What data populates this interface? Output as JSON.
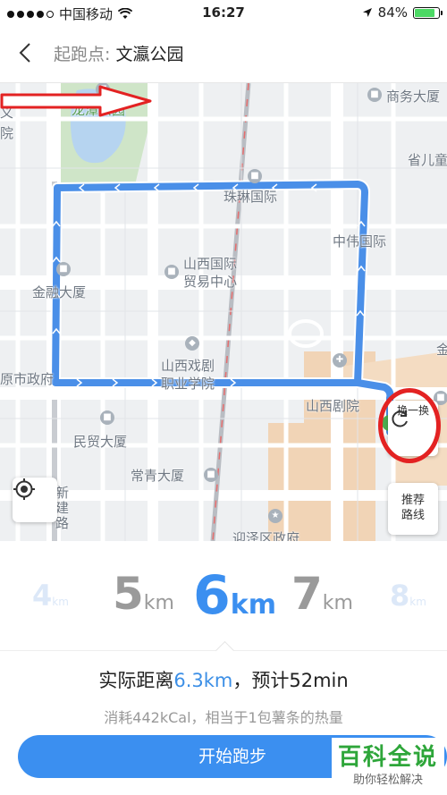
{
  "status_bar": {
    "carrier": "中国移动",
    "time": "16:27",
    "battery_percent": "84%",
    "battery_level": 0.84,
    "signal_bars_filled": 4,
    "signal_bars_total": 5
  },
  "header": {
    "title_prefix": "起跑点:",
    "title_value": "文瀛公园"
  },
  "map": {
    "pois": {
      "longtan": "龙潭公园",
      "shangwu": "商务大厦",
      "shengji": "省儿童",
      "zhulin": "珠琳国际",
      "zhongwei": "中伟国际",
      "jinrong": "金融大厦",
      "shanxi_guoji_1": "山西国际",
      "shanxi_guoji_2": "贸易中心",
      "xiju_1": "山西戏剧",
      "xiju_2": "职业学院",
      "juyuan": "山西剧院",
      "shizhengfu": "原市政府",
      "minmao": "民贸大厦",
      "changqing": "常青大厦",
      "yingze": "迎泽区政府",
      "xinjian": "新建路",
      "edge_yi": "义",
      "edge_yuan": "院",
      "edge_jin": "金"
    },
    "refresh_label": "换一换",
    "route_label_1": "推荐",
    "route_label_2": "路线",
    "route_color": "#4a8fe8",
    "annotation_color": "#e32222"
  },
  "distance_picker": {
    "unit": "km",
    "options": [
      "4",
      "5",
      "6",
      "7",
      "8"
    ],
    "selected": "6"
  },
  "summary": {
    "distance_prefix": "实际距离",
    "distance_value": "6.3km",
    "duration_text": "，预计52min",
    "calories_text": "消耗442kCal，相当于1包薯条的热量"
  },
  "start_button_label": "开始跑步",
  "watermark": {
    "title": "百科全说",
    "subtitle": "助你轻松解决"
  }
}
